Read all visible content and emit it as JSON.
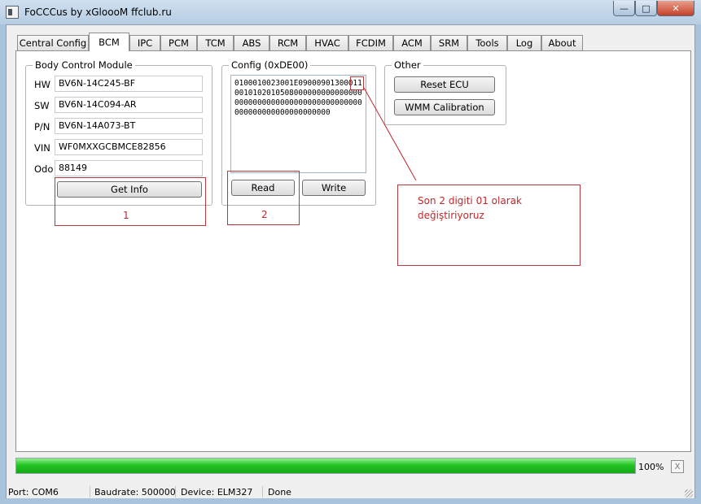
{
  "window": {
    "title": "FoCCCus by xGloooM ffclub.ru"
  },
  "tabs": [
    {
      "label": "Central Config"
    },
    {
      "label": "BCM",
      "active": true
    },
    {
      "label": "IPC"
    },
    {
      "label": "PCM"
    },
    {
      "label": "TCM"
    },
    {
      "label": "ABS"
    },
    {
      "label": "RCM"
    },
    {
      "label": "HVAC"
    },
    {
      "label": "FCDIM"
    },
    {
      "label": "ACM"
    },
    {
      "label": "SRM"
    },
    {
      "label": "Tools"
    },
    {
      "label": "Log"
    },
    {
      "label": "About"
    }
  ],
  "bcm": {
    "title": "Body Control Module",
    "fields": [
      {
        "label": "HW",
        "value": "BV6N-14C245-BF"
      },
      {
        "label": "SW",
        "value": "BV6N-14C094-AR"
      },
      {
        "label": "P/N",
        "value": "BV6N-14A073-BT"
      },
      {
        "label": "VIN",
        "value": "WF0MXXGCBMCE82856"
      },
      {
        "label": "Odo",
        "value": "88149"
      }
    ],
    "get_info_label": "Get Info"
  },
  "config": {
    "title": "Config (0xDE00)",
    "text": "0100010023001E0900090130001100101020105080000000000000000000000000000000000000000000000000000000000000000",
    "read_label": "Read",
    "write_label": "Write"
  },
  "other": {
    "title": "Other",
    "reset_label": "Reset ECU",
    "wmm_label": "WMM Calibration"
  },
  "annotations": {
    "box1_label": "1",
    "box2_label": "2",
    "note_line1": "Son 2 digiti 01 olarak",
    "note_line2": "değiştiriyoruz"
  },
  "progress": {
    "value": 100,
    "label": "100%",
    "close": "X"
  },
  "status": {
    "port": "Port: COM6",
    "baudrate": "Baudrate: 500000",
    "device": "Device: ELM327",
    "state": "Done"
  },
  "colors": {
    "annotation": "#c0282c",
    "progress": "#23c423"
  }
}
